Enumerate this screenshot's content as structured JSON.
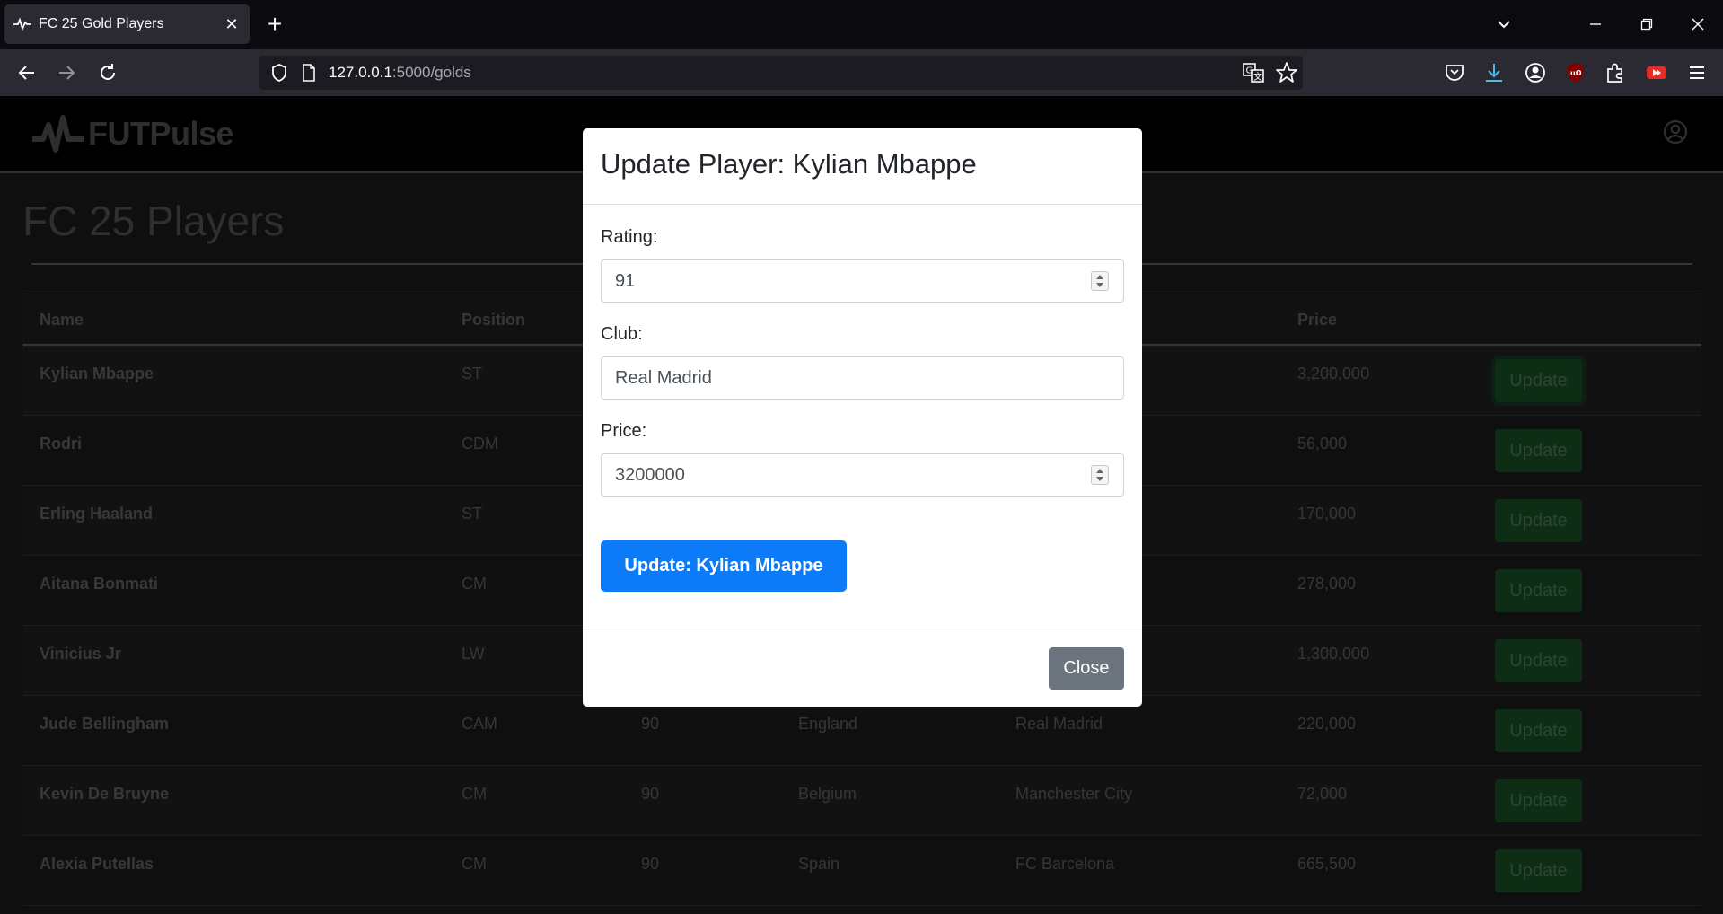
{
  "browser": {
    "tab_title": "FC 25 Gold Players",
    "url_host": "127.0.0.1",
    "url_rest": ":5000/golds",
    "icons": [
      "back-icon",
      "forward-icon",
      "reload-icon",
      "shield-icon",
      "page-icon",
      "translate-icon",
      "bookmark-star-icon",
      "pocket-icon",
      "download-icon",
      "account-icon",
      "ublock-icon",
      "extensions-icon",
      "youtube-icon",
      "menu-icon"
    ]
  },
  "site": {
    "brand": "FUTPulse",
    "page_title": "FC 25 Players"
  },
  "table": {
    "headers": [
      "Name",
      "Position",
      "",
      "",
      "",
      "Price"
    ],
    "rows": [
      {
        "name": "Kylian Mbappe",
        "position": "ST",
        "rating": "",
        "nation": "",
        "club": "",
        "price": "3,200,000",
        "action": "Update"
      },
      {
        "name": "Rodri",
        "position": "CDM",
        "rating": "",
        "nation": "",
        "club": "",
        "price": "56,000",
        "action": "Update"
      },
      {
        "name": "Erling Haaland",
        "position": "ST",
        "rating": "",
        "nation": "",
        "club": "",
        "price": "170,000",
        "action": "Update"
      },
      {
        "name": "Aitana Bonmati",
        "position": "CM",
        "rating": "",
        "nation": "",
        "club": "",
        "price": "278,000",
        "action": "Update"
      },
      {
        "name": "Vinicius Jr",
        "position": "LW",
        "rating": "",
        "nation": "",
        "club": "",
        "price": "1,300,000",
        "action": "Update"
      },
      {
        "name": "Jude Bellingham",
        "position": "CAM",
        "rating": "90",
        "nation": "England",
        "club": "Real Madrid",
        "price": "220,000",
        "action": "Update"
      },
      {
        "name": "Kevin De Bruyne",
        "position": "CM",
        "rating": "90",
        "nation": "Belgium",
        "club": "Manchester City",
        "price": "72,000",
        "action": "Update"
      },
      {
        "name": "Alexia Putellas",
        "position": "CM",
        "rating": "90",
        "nation": "Spain",
        "club": "FC Barcelona",
        "price": "665,500",
        "action": "Update"
      }
    ]
  },
  "modal": {
    "title": "Update Player: Kylian Mbappe",
    "rating_label": "Rating:",
    "rating_value": "91",
    "club_label": "Club:",
    "club_value": "Real Madrid",
    "price_label": "Price:",
    "price_value": "3200000",
    "submit_label": "Update: Kylian Mbappe",
    "close_label": "Close"
  },
  "colors": {
    "primary": "#0d7bf7",
    "secondary": "#6c757d",
    "success_dim": "#1d5a2b"
  }
}
